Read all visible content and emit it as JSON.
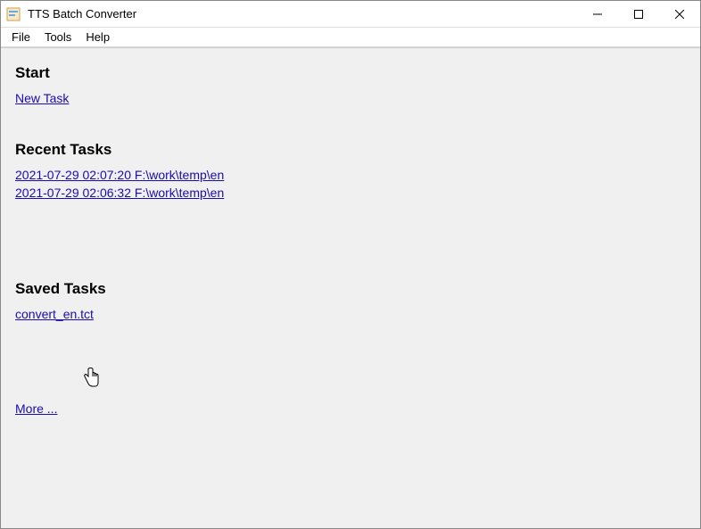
{
  "window": {
    "title": "TTS Batch Converter"
  },
  "menu": {
    "file": "File",
    "tools": "Tools",
    "help": "Help"
  },
  "sections": {
    "start": {
      "heading": "Start",
      "new_task": "New Task"
    },
    "recent": {
      "heading": "Recent Tasks",
      "items": [
        "2021-07-29 02:07:20  F:\\work\\temp\\en",
        "2021-07-29 02:06:32  F:\\work\\temp\\en"
      ]
    },
    "saved": {
      "heading": "Saved Tasks",
      "items": [
        "convert_en.tct"
      ]
    },
    "more": "More ..."
  }
}
